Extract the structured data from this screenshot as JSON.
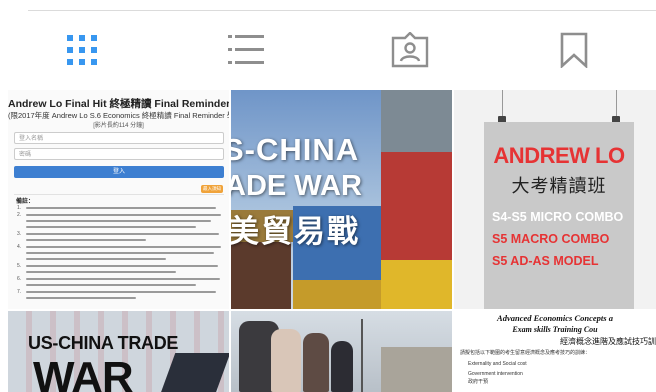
{
  "tabs": [
    {
      "name": "grid",
      "icon": "grid-icon",
      "active": true
    },
    {
      "name": "feed",
      "icon": "list-icon",
      "active": false
    },
    {
      "name": "tagged",
      "icon": "tagged-user-icon",
      "active": false
    },
    {
      "name": "saved",
      "icon": "bookmark-icon",
      "active": false
    }
  ],
  "accent_color": "#3897f0",
  "icon_color": "#8e8e8e",
  "posts": {
    "p1": {
      "title": "Andrew Lo Final Hit 終極精讀 Final Reminder",
      "subtitle": "(限2017年度 Andrew Lo S.6 Economics 終極精讀 Final Reminder 學生登",
      "subtitle2": "[影片長約114 分鐘]",
      "login_placeholder": "登入名稱",
      "password_placeholder": "密碼",
      "login_button": "登入",
      "badge": "最入須知",
      "notes_heading": "備註："
    },
    "p2": {
      "line1": "S-CHINA",
      "line2": "ADE WAR",
      "line3": "美貿易戰"
    },
    "p3": {
      "name": "ANDREW LO",
      "cn": "大考精讀班",
      "line1": "S4-S5 MICRO COMBO",
      "line2": "S5 MACRO COMBO",
      "line3": "S5 AD-AS MODEL"
    },
    "p4": {
      "line1": "US-CHINA TRADE",
      "line2": "WAR"
    },
    "p6": {
      "title1": "Advanced Economics Concepts a",
      "title2": "Exam skills Training Cou",
      "title3": "經濟概念進階及應試技巧訓",
      "intro": "請擬包括以下範圍的考生留意經濟概念及應考技巧的訓練：",
      "items": [
        "Externality and Social cost",
        "Government intervention",
        "政府干預"
      ]
    }
  }
}
